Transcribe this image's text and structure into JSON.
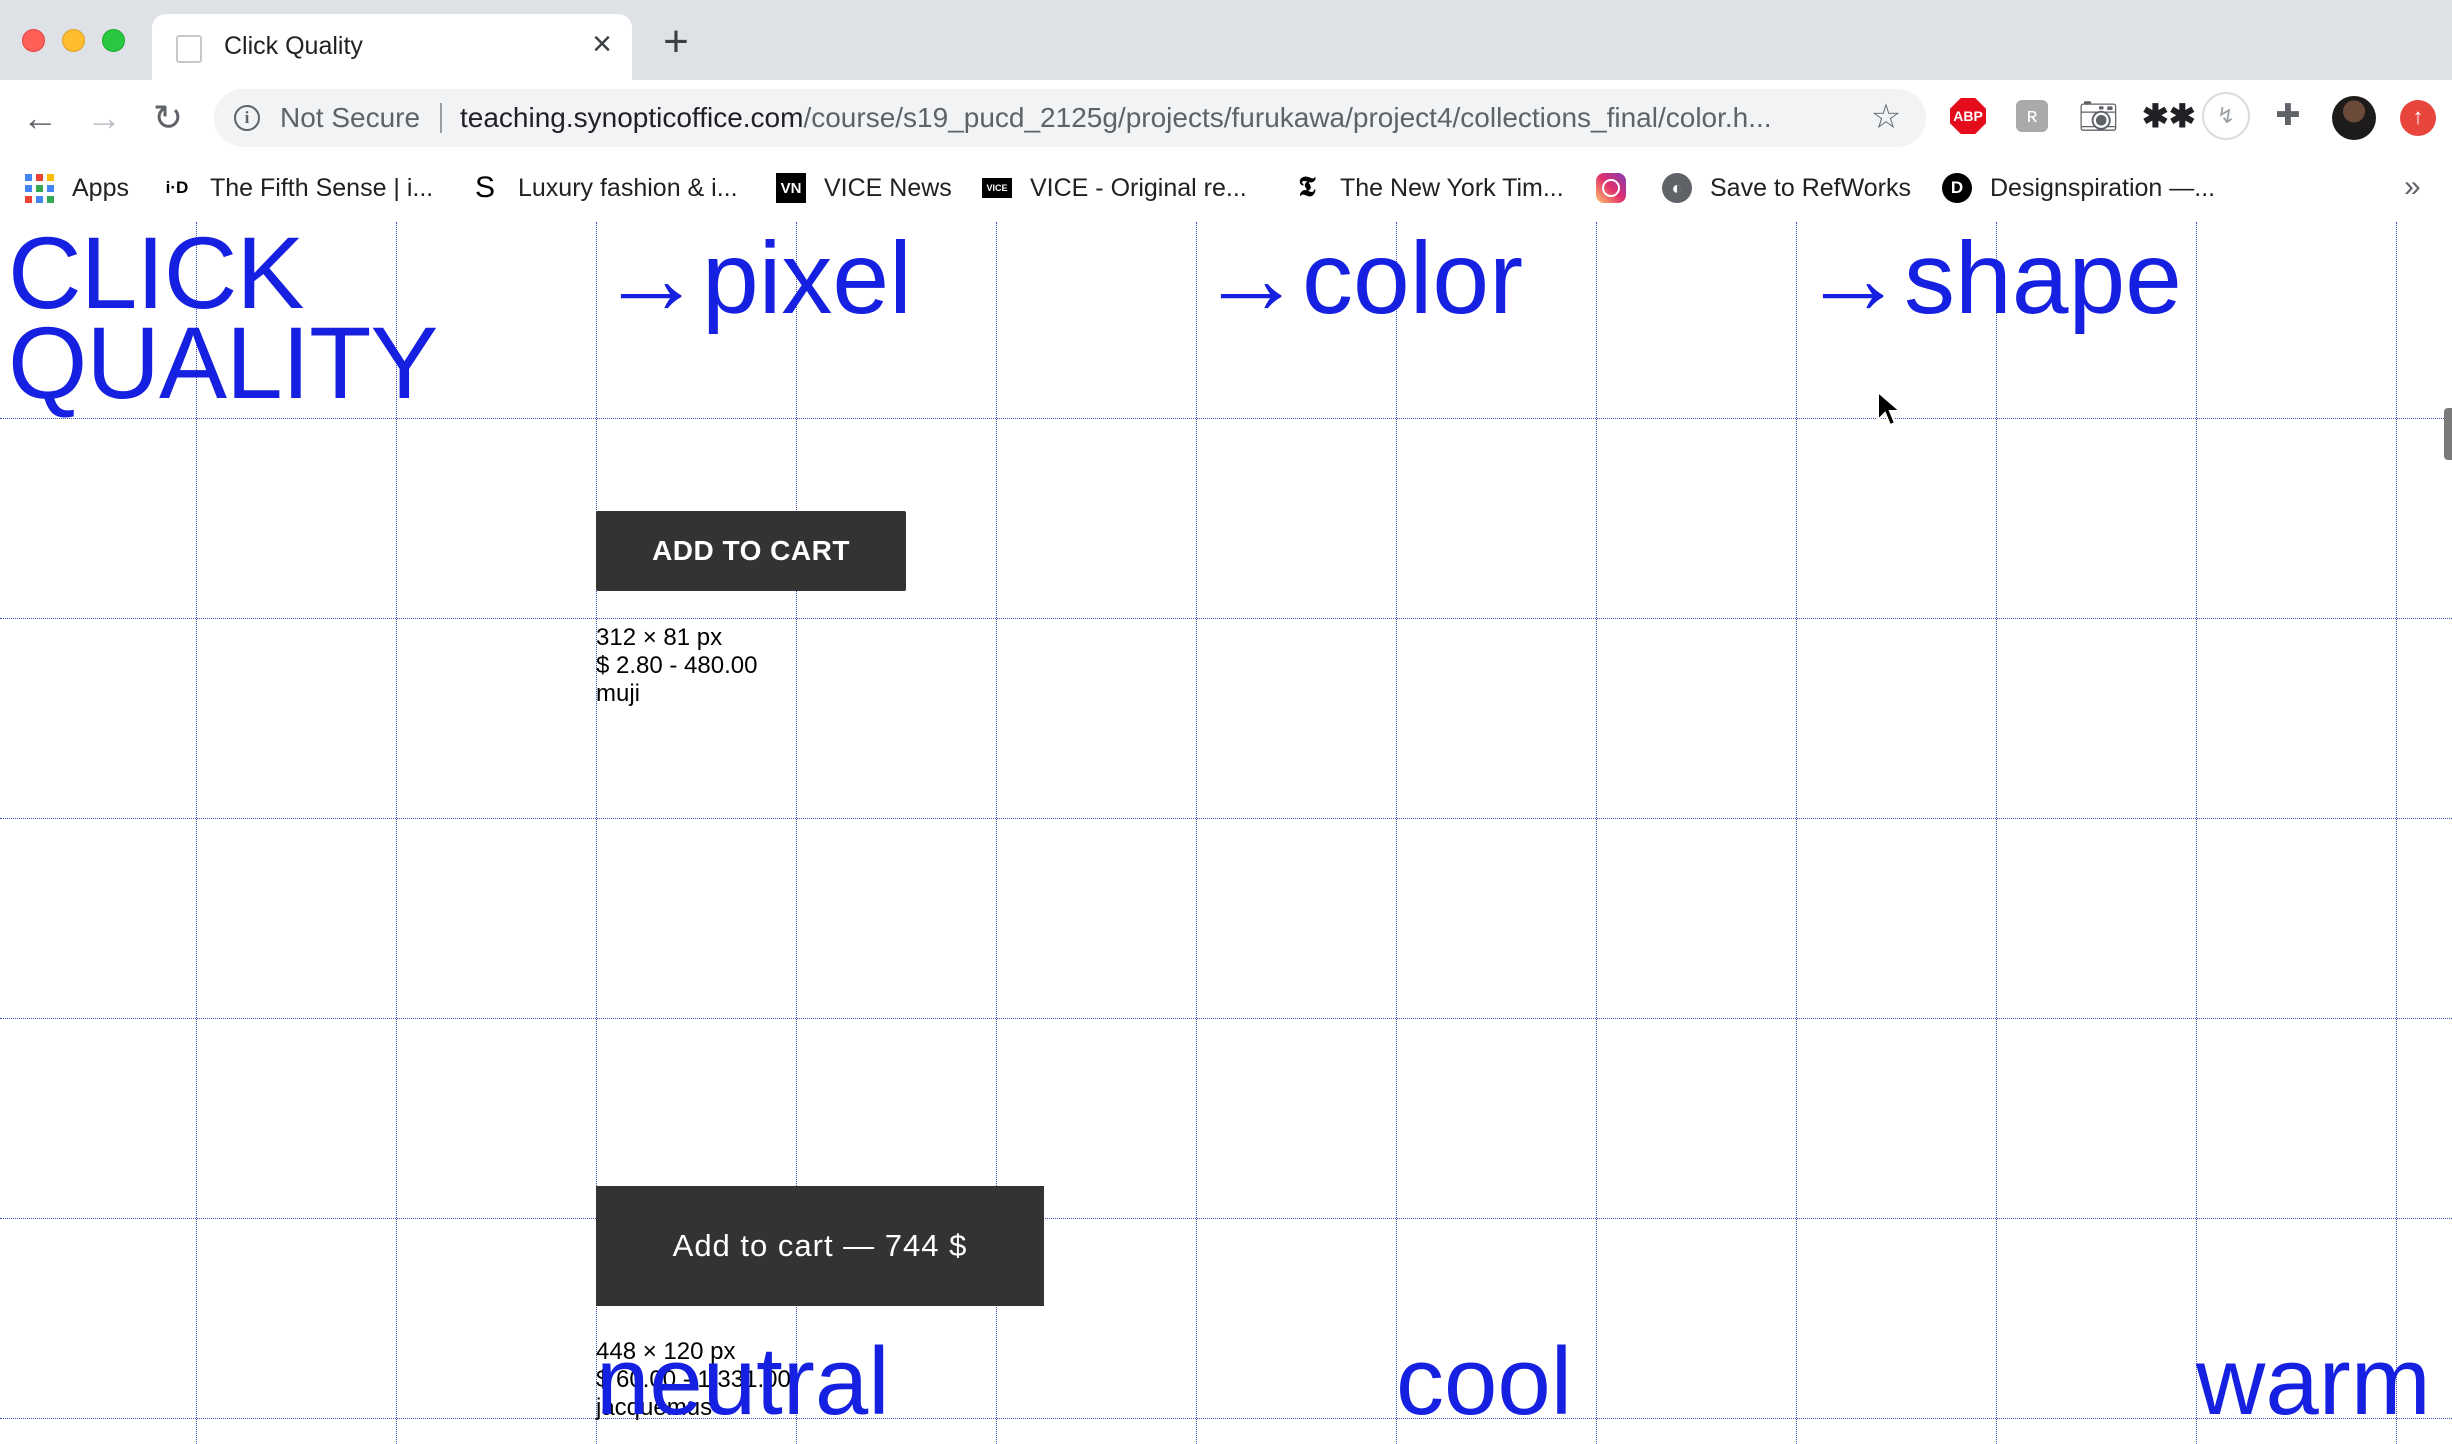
{
  "browser": {
    "tab_title": "Click Quality",
    "url_security": "Not Secure",
    "url_host": "teaching.synopticoffice.com",
    "url_path": "/course/s19_pucd_2125g/projects/furukawa/project4/collections_final/color.h...",
    "bookmarks": [
      {
        "label": "Apps",
        "icon": "apps-grid-icon"
      },
      {
        "label": "The Fifth Sense | i...",
        "icon": "i-d-icon"
      },
      {
        "label": "Luxury fashion & i...",
        "icon": "s-logo-icon"
      },
      {
        "label": "VICE News",
        "icon": "vn-icon"
      },
      {
        "label": "VICE - Original re...",
        "icon": "vice-icon"
      },
      {
        "label": "The New York Tim...",
        "icon": "nyt-icon"
      },
      {
        "label": "",
        "icon": "instagram-icon"
      },
      {
        "label": "Save to RefWorks",
        "icon": "globe-icon"
      },
      {
        "label": "Designspiration —...",
        "icon": "designspiration-icon"
      }
    ],
    "colors": {
      "tabstrip": "#dee1e6",
      "omnibox": "#f1f3f4"
    }
  },
  "page": {
    "title_line1": "CLICK",
    "title_line2": "QUALITY",
    "nav": [
      "→pixel",
      "→color",
      "→shape"
    ],
    "item1": {
      "button_label": "ADD TO CART",
      "size": "312 × 81 px",
      "price": "$ 2.80 - 480.00",
      "brand": "muji"
    },
    "item2": {
      "button_label": "Add to cart — 744 $",
      "size": "448 × 120 px",
      "price": "$ 60.00 - 1,331.00",
      "brand": "jacquemus"
    },
    "categories": [
      "neutral",
      "cool",
      "warm"
    ],
    "colors": {
      "accent": "#1520e0",
      "grid": "#3a4fb8",
      "button": "#333333"
    }
  }
}
